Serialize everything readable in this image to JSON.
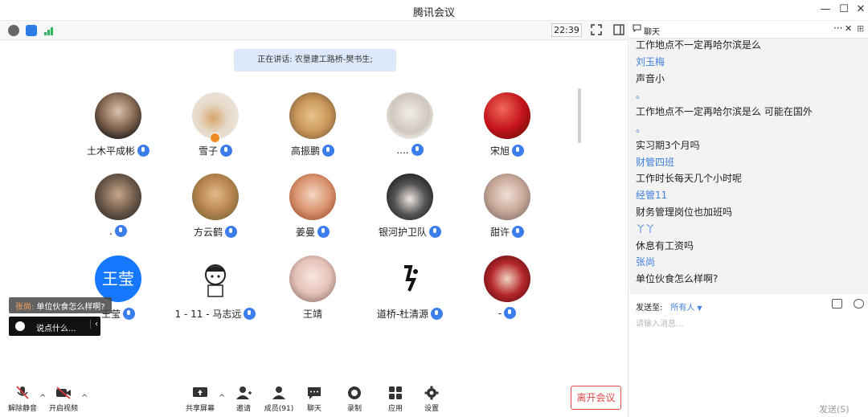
{
  "app": {
    "title": "腾讯会议",
    "clock": "22:39"
  },
  "speaking": "正在讲话: 农垦建工路桥-樊书生;",
  "participants": [
    {
      "name": "土木平成彬"
    },
    {
      "name": "雪子"
    },
    {
      "name": "高振鹏"
    },
    {
      "name": "...."
    },
    {
      "name": "宋旭"
    },
    {
      "name": "."
    },
    {
      "name": "方云鹤"
    },
    {
      "name": "姜曼"
    },
    {
      "name": "银河护卫队"
    },
    {
      "name": "甜许"
    },
    {
      "name": "王莹",
      "avatar_text": "王莹"
    },
    {
      "name": "1 - 11 - 马志远"
    },
    {
      "name": "王靖"
    },
    {
      "name": "道桥-杜清源"
    },
    {
      "name": "-"
    }
  ],
  "float_chat": {
    "sender": "张尚:",
    "text": "单位伙食怎么样啊?",
    "input_placeholder": "说点什么..."
  },
  "toolbar": {
    "unmute": "解除静音",
    "video": "开启视频",
    "share": "共享屏幕",
    "invite": "邀请",
    "members": "成员(91)",
    "chat": "聊天",
    "record": "录制",
    "apps": "应用",
    "settings": "设置",
    "leave": "离开会议"
  },
  "chat": {
    "title": "聊天",
    "lines": [
      {
        "type": "msg",
        "text": "工作地点不一定再哈尔滨是么"
      },
      {
        "type": "sender",
        "text": "刘玉梅"
      },
      {
        "type": "msg",
        "text": "声音小"
      },
      {
        "type": "sender",
        "text": "。"
      },
      {
        "type": "msg",
        "text": "工作地点不一定再哈尔滨是么 可能在国外"
      },
      {
        "type": "sender",
        "text": "。"
      },
      {
        "type": "msg",
        "text": "实习期3个月吗"
      },
      {
        "type": "sender",
        "text": "财管四班"
      },
      {
        "type": "msg",
        "text": "工作时长每天几个小时呢"
      },
      {
        "type": "sender",
        "text": "经管11"
      },
      {
        "type": "msg",
        "text": "财务管理岗位也加班吗"
      },
      {
        "type": "sender",
        "text": "丫丫"
      },
      {
        "type": "msg",
        "text": "休息有工资吗"
      },
      {
        "type": "sender",
        "text": "张尚"
      },
      {
        "type": "msg",
        "text": "单位伙食怎么样啊?"
      }
    ],
    "send_to_label": "发送至:",
    "send_to_value": "所有人",
    "input_placeholder": "请输入消息...",
    "send_button": "发送(S)"
  }
}
